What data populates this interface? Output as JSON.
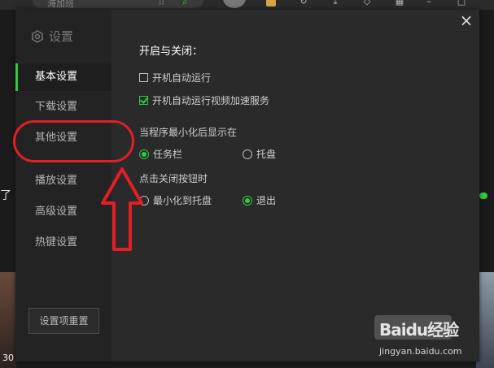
{
  "background": {
    "search_hint": "海加班",
    "left_text": "了",
    "thumb_number": "30"
  },
  "dialog": {
    "sidebar_title": "设置",
    "nav": [
      {
        "label": "基本设置",
        "active": true
      },
      {
        "label": "下载设置",
        "active": false
      },
      {
        "label": "其他设置",
        "active": false
      },
      {
        "label": "播放设置",
        "active": false
      },
      {
        "label": "高级设置",
        "active": false
      },
      {
        "label": "热键设置",
        "active": false
      }
    ],
    "reset_label": "设置项重置",
    "close_glyph": "×",
    "section_title": "开启与关闭：",
    "checkboxes": [
      {
        "label": "开机自动运行",
        "checked": false
      },
      {
        "label": "开机自动运行视频加速服务",
        "checked": true
      }
    ],
    "minimize_group": {
      "label": "当程序最小化后显示在",
      "options": [
        {
          "label": "任务栏",
          "checked": true
        },
        {
          "label": "托盘",
          "checked": false
        }
      ]
    },
    "close_group": {
      "label": "点击关闭按钮时",
      "options": [
        {
          "label": "最小化到托盘",
          "checked": false
        },
        {
          "label": "退出",
          "checked": true
        }
      ]
    }
  },
  "watermark": {
    "logo": "Baidu经验",
    "url": "jingyan.baidu.com"
  },
  "colors": {
    "accent": "#2fcc3f",
    "annotation": "#e31e24",
    "dialog_bg": "#2a2a2a",
    "sidebar_bg": "#232323"
  }
}
